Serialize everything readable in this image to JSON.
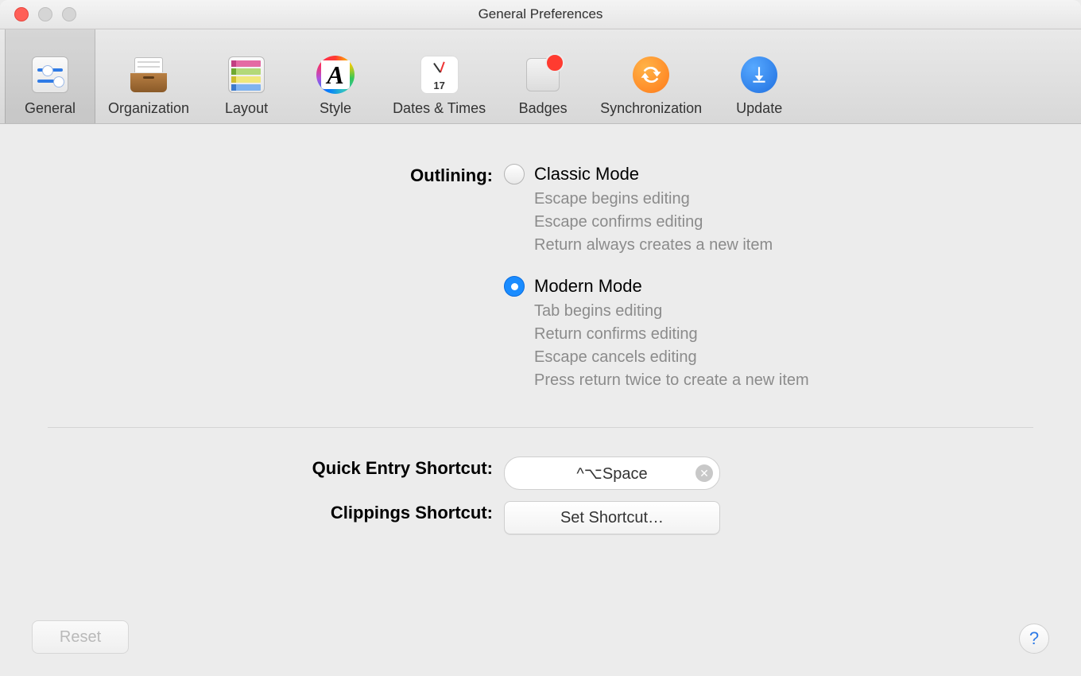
{
  "window_title": "General Preferences",
  "toolbar": [
    {
      "id": "general",
      "label": "General",
      "selected": true
    },
    {
      "id": "organization",
      "label": "Organization",
      "selected": false
    },
    {
      "id": "layout",
      "label": "Layout",
      "selected": false
    },
    {
      "id": "style",
      "label": "Style",
      "selected": false
    },
    {
      "id": "dates",
      "label": "Dates & Times",
      "selected": false
    },
    {
      "id": "badges",
      "label": "Badges",
      "selected": false
    },
    {
      "id": "sync",
      "label": "Synchronization",
      "selected": false
    },
    {
      "id": "update",
      "label": "Update",
      "selected": false
    }
  ],
  "calendar_day": "17",
  "outlining": {
    "label": "Outlining:",
    "classic": {
      "title": "Classic Mode",
      "checked": false,
      "desc": [
        "Escape begins editing",
        "Escape confirms editing",
        "Return always creates a new item"
      ]
    },
    "modern": {
      "title": "Modern Mode",
      "checked": true,
      "desc": [
        "Tab begins editing",
        "Return confirms editing",
        "Escape cancels editing",
        "Press return twice to create a new item"
      ]
    }
  },
  "quick_entry": {
    "label": "Quick Entry Shortcut:",
    "value": "^⌥Space"
  },
  "clippings": {
    "label": "Clippings Shortcut:",
    "button": "Set Shortcut…"
  },
  "reset_label": "Reset",
  "help_label": "?"
}
